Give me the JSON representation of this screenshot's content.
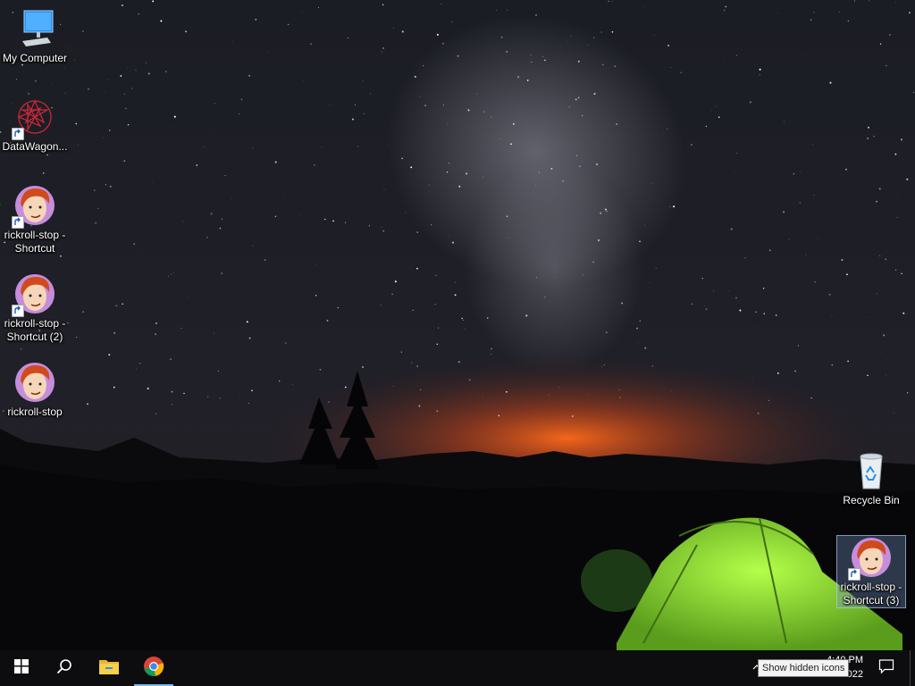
{
  "desktop": {
    "icons": [
      {
        "label": "My Computer",
        "icon": "computer-icon"
      },
      {
        "label": "DataWagon...",
        "icon": "datawagon-icon"
      },
      {
        "label": "rickroll-stop - Shortcut",
        "icon": "rickroll-face-icon"
      },
      {
        "label": "rickroll-stop - Shortcut (2)",
        "icon": "rickroll-face-icon"
      },
      {
        "label": "rickroll-stop",
        "icon": "rickroll-face-icon"
      },
      {
        "label": "Recycle Bin",
        "icon": "recycle-bin-icon"
      },
      {
        "label": "rickroll-stop - Shortcut (3)",
        "icon": "rickroll-face-icon",
        "selected": true
      }
    ]
  },
  "taskbar": {
    "start": "windows-start-icon",
    "search": "search-icon",
    "pinned": [
      "file-explorer-icon",
      "chrome-icon"
    ],
    "tray": {
      "time": "4:40 PM",
      "date": "2/27/2022",
      "tooltip": "Show hidden icons"
    }
  },
  "colors": {
    "taskbar": "#0d0d0f",
    "accent": "#76b9ed",
    "tent": "#8fe33a"
  }
}
